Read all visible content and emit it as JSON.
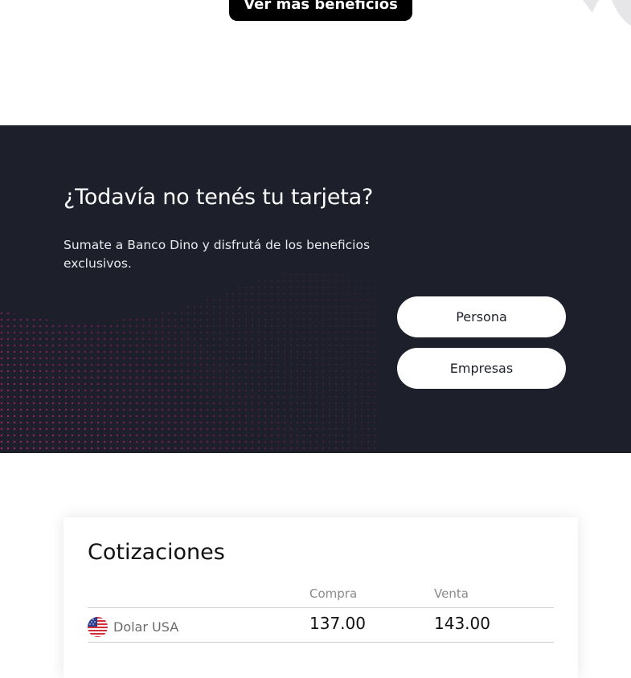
{
  "benefits": {
    "more_label": "Ver más beneficios"
  },
  "cta": {
    "title": "¿Todavía no tenés tu tarjeta?",
    "subtitle": "Sumate a Banco Dino y disfrutá de los beneficios exclusivos.",
    "buttons": [
      "Persona",
      "Empresas"
    ]
  },
  "quotes": {
    "title": "Cotizaciones",
    "columns": [
      "Compra",
      "Venta"
    ],
    "rows": [
      {
        "currency": "Dolar USA",
        "flag_icon": "us-flag-icon",
        "compra": "137.00",
        "venta": "143.00"
      }
    ]
  },
  "colors": {
    "band_bg": "#1d1f2b",
    "button_bg": "#000000",
    "accent_wave": "#b0207a"
  }
}
